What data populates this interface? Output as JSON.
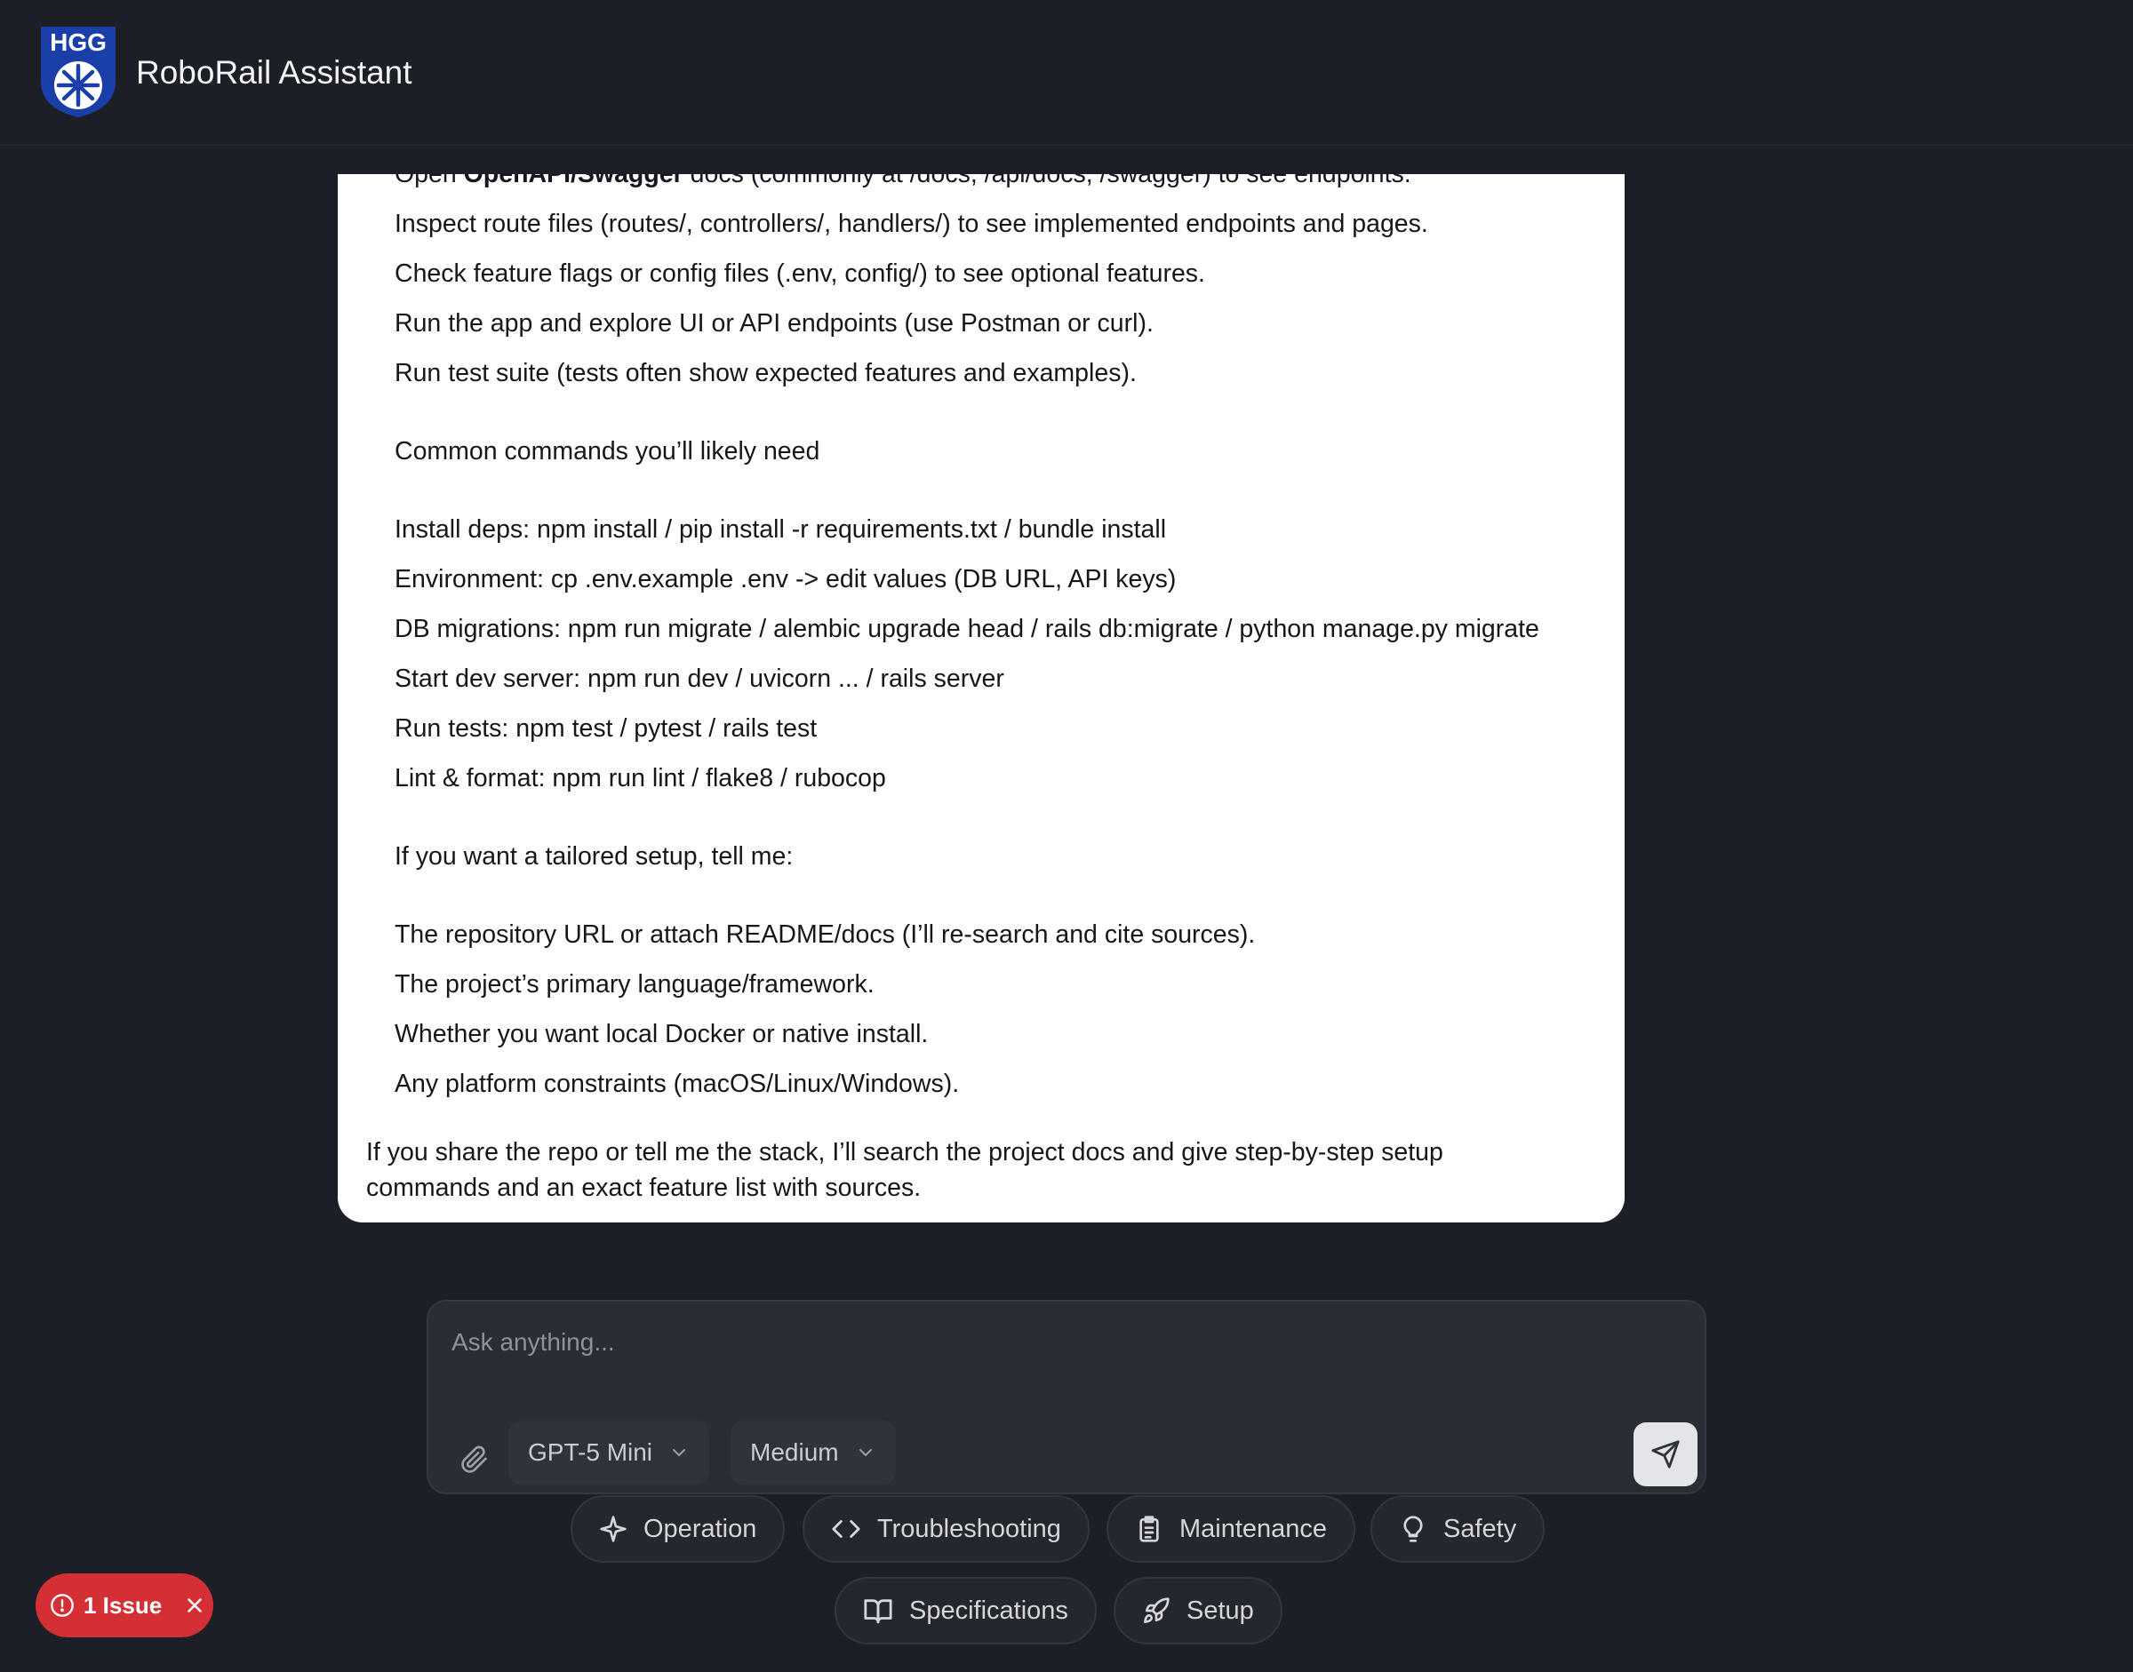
{
  "header": {
    "logo_text": "HGG",
    "title": "RoboRail Assistant"
  },
  "message": {
    "partial_line": {
      "prefix": "Open ",
      "bold": "OpenAPI/Swagger",
      "suffix": " docs (commonly at /docs, /api/docs, /swagger) to see endpoints."
    },
    "inspect_items": [
      "Inspect route files (routes/, controllers/, handlers/) to see implemented endpoints and pages.",
      "Check feature flags or config files (.env, config/) to see optional features.",
      "Run the app and explore UI or API endpoints (use Postman or curl).",
      "Run test suite (tests often show expected features and examples)."
    ],
    "commands_heading": "Common commands you’ll likely need",
    "commands": [
      "Install deps: npm install / pip install -r requirements.txt / bundle install",
      "Environment: cp .env.example .env -> edit values (DB URL, API keys)",
      "DB migrations: npm run migrate / alembic upgrade head / rails db:migrate / python manage.py migrate",
      "Start dev server: npm run dev / uvicorn ... / rails server",
      "Run tests: npm test / pytest / rails test",
      "Lint & format: npm run lint / flake8 / rubocop"
    ],
    "tailored_heading": "If you want a tailored setup, tell me:",
    "tailored_items": [
      "The repository URL or attach README/docs (I’ll re-search and cite sources).",
      "The project’s primary language/framework.",
      "Whether you want local Docker or native install.",
      "Any platform constraints (macOS/Linux/Windows)."
    ],
    "closing": "If you share the repo or tell me the stack, I’ll search the project docs and give step-by-step setup commands and an exact feature list with sources."
  },
  "composer": {
    "placeholder": "Ask anything...",
    "model": "GPT-5 Mini",
    "effort": "Medium",
    "attach_icon": "paperclip-icon",
    "send_icon": "send-icon"
  },
  "quick_actions": [
    {
      "label": "Operation",
      "icon": "sparkle-icon"
    },
    {
      "label": "Troubleshooting",
      "icon": "code-icon"
    },
    {
      "label": "Maintenance",
      "icon": "clipboard-icon"
    },
    {
      "label": "Safety",
      "icon": "lightbulb-icon"
    },
    {
      "label": "Specifications",
      "icon": "book-icon"
    },
    {
      "label": "Setup",
      "icon": "rocket-icon"
    }
  ],
  "issue_badge": {
    "label": "1 Issue",
    "color": "#d32f35"
  }
}
